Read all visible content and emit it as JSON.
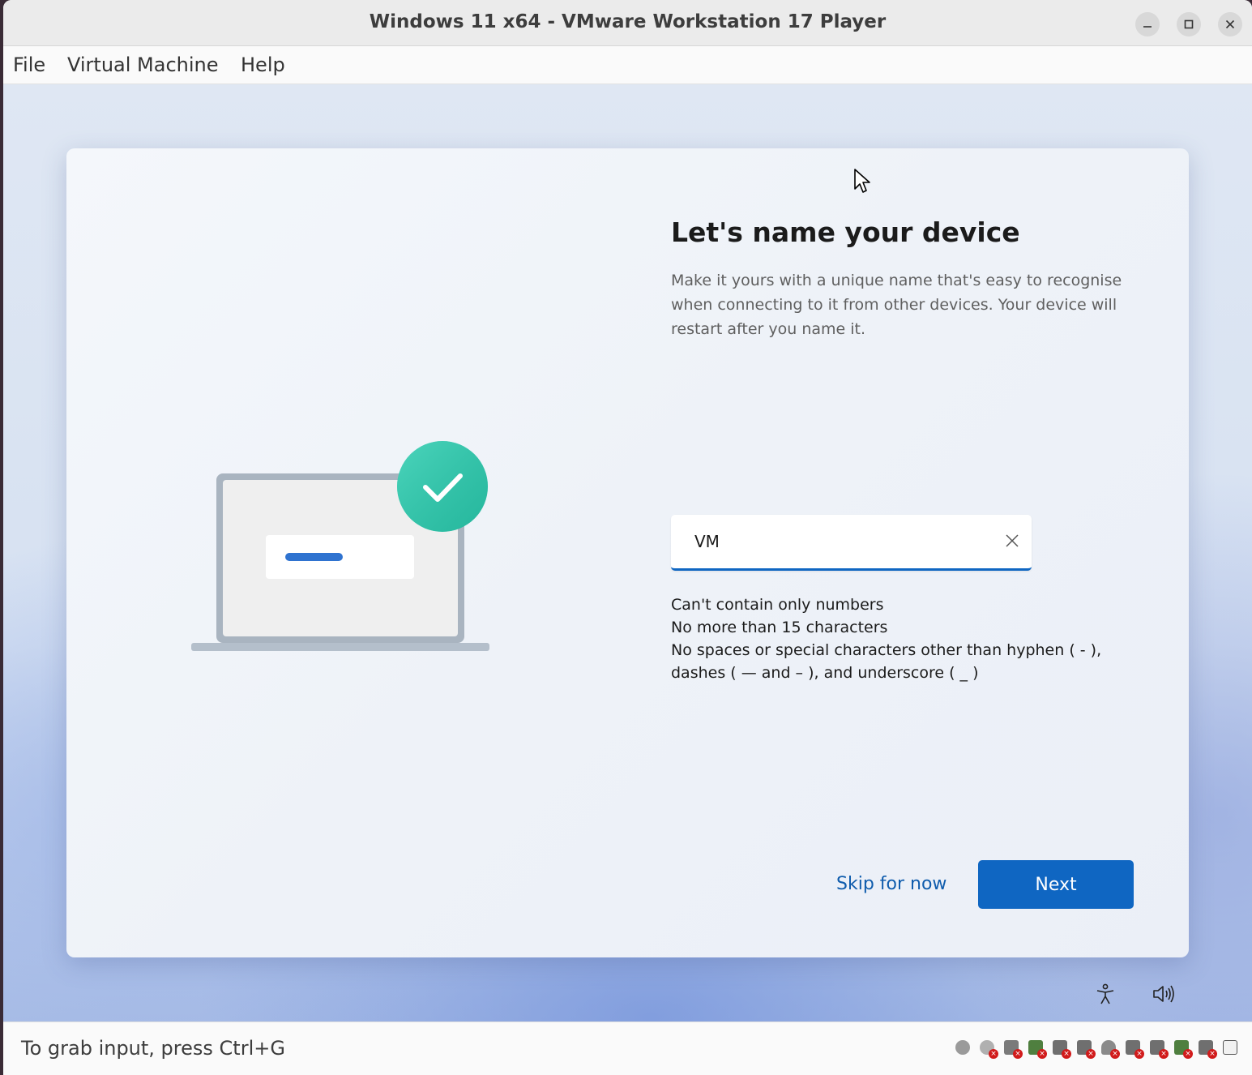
{
  "window": {
    "title": "Windows 11 x64 - VMware Workstation 17 Player"
  },
  "menu": {
    "items": [
      {
        "label": "File"
      },
      {
        "label": "Virtual Machine"
      },
      {
        "label": "Help"
      }
    ]
  },
  "setup": {
    "heading": "Let's name your device",
    "description": "Make it yours with a unique name that's easy to recognise when connecting to it from other devices. Your device will restart after you name it.",
    "device_name_value": "VM",
    "rules": [
      "Can't contain only numbers",
      "No more than 15 characters",
      "No spaces or special characters other than hyphen ( - ), dashes ( — and – ), and underscore ( _ )"
    ],
    "skip_label": "Skip for now",
    "next_label": "Next"
  },
  "status": {
    "text": "To grab input, press Ctrl+G",
    "devices": [
      "hard-disk",
      "cd-dvd",
      "network-adapter",
      "network-adapter-2",
      "usb-controller",
      "usb-1",
      "wireless",
      "usb-2",
      "usb-3",
      "printer",
      "sound-card",
      "display"
    ]
  },
  "colors": {
    "accent": "#0f66c2",
    "check_badge": "#2ec4a8"
  }
}
